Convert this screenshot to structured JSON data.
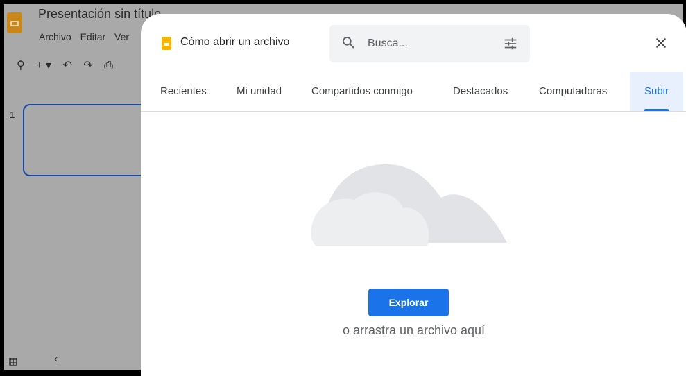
{
  "app": {
    "title": "Presentación sin título",
    "menu": [
      "Archivo",
      "Editar",
      "Ver"
    ],
    "slide_number": "1",
    "toolbar_icons": [
      "zoom-icon",
      "add-icon",
      "undo-icon",
      "redo-icon",
      "print-icon"
    ]
  },
  "dialog": {
    "title": "Cómo abrir un archivo",
    "search": {
      "placeholder": "Busca..."
    },
    "tabs": [
      {
        "label": "Recientes"
      },
      {
        "label": "Mi unidad"
      },
      {
        "label": "Compartidos conmigo"
      },
      {
        "label": "Destacados"
      },
      {
        "label": "Computadoras"
      },
      {
        "label": "Subir",
        "active": true
      }
    ],
    "upload": {
      "button_label": "Explorar",
      "drag_text": "o arrastra un archivo aquí"
    }
  },
  "colors": {
    "accent": "#1a73e8",
    "slides_icon": "#f6b400",
    "background_app": "#a9a9a9"
  }
}
